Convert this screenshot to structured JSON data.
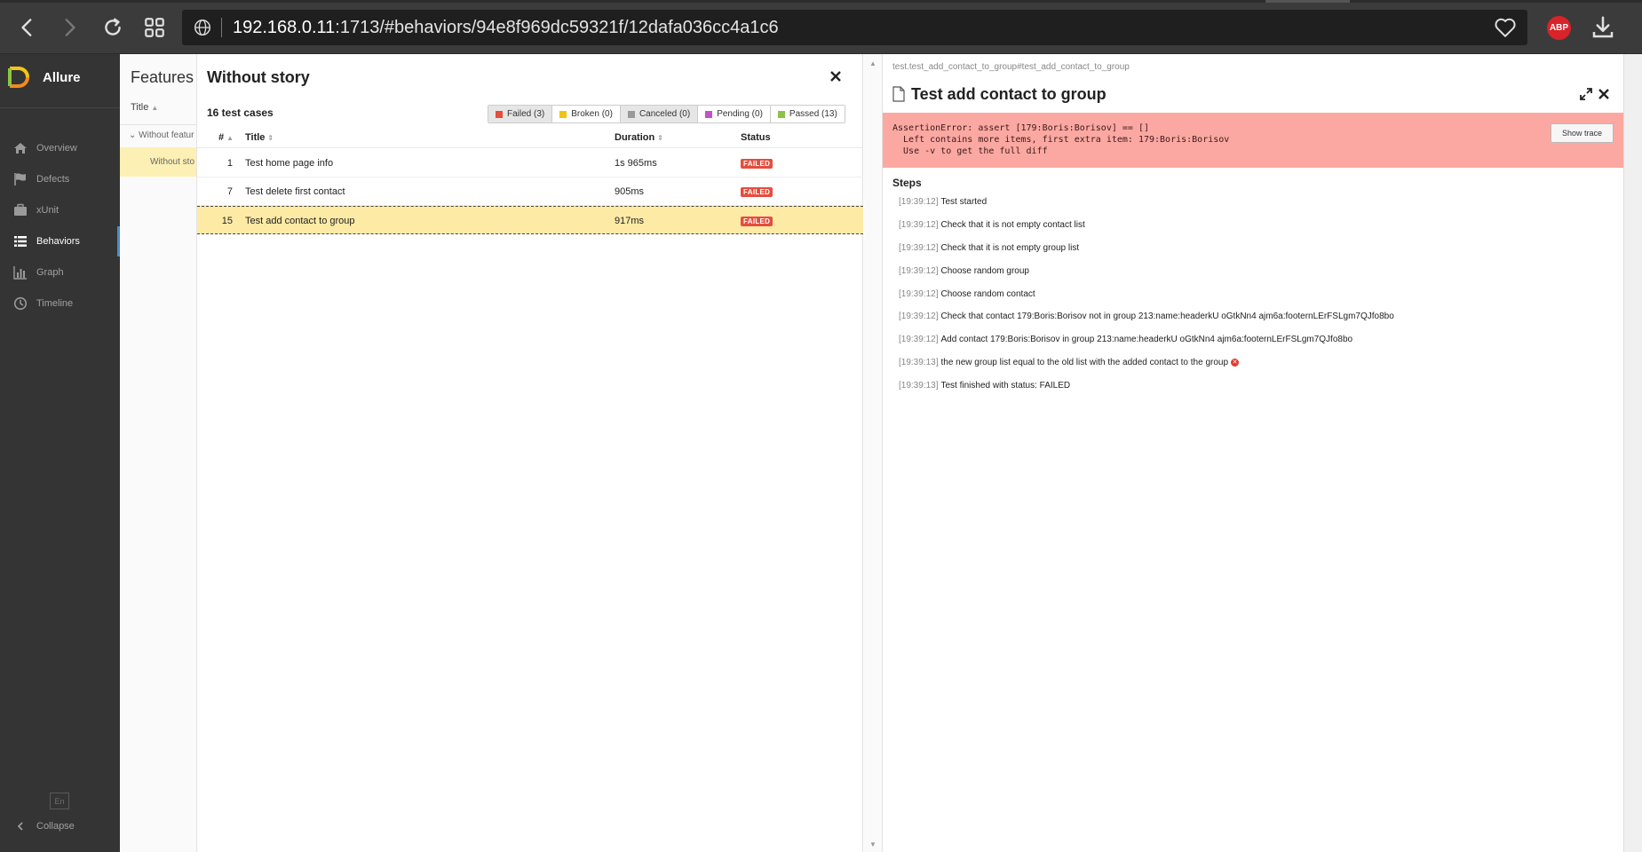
{
  "browser": {
    "url_host": "192.168.0.11",
    "url_rest": ":1713/#behaviors/94e8f969dc59321f/12dafa036cc4a1c6",
    "abp_label": "ABP"
  },
  "sidebar": {
    "brand": "Allure",
    "items": [
      {
        "label": "Overview",
        "icon": "home-icon"
      },
      {
        "label": "Defects",
        "icon": "flag-icon"
      },
      {
        "label": "xUnit",
        "icon": "briefcase-icon"
      },
      {
        "label": "Behaviors",
        "icon": "list-icon",
        "active": true
      },
      {
        "label": "Graph",
        "icon": "bar-chart-icon"
      },
      {
        "label": "Timeline",
        "icon": "clock-icon"
      }
    ],
    "lang": "En",
    "collapse_label": "Collapse"
  },
  "features": {
    "title": "Features",
    "column_title": "Title",
    "group_label": "Without featur",
    "selected_item": "Without sto"
  },
  "list_panel": {
    "title": "Without story",
    "count": "16 test cases",
    "filters": [
      {
        "label": "Failed (3)",
        "color": "#e74c3c",
        "on": true
      },
      {
        "label": "Broken (0)",
        "color": "#f1c40f",
        "on": false
      },
      {
        "label": "Canceled (0)",
        "color": "#999999",
        "on": true
      },
      {
        "label": "Pending (0)",
        "color": "#c352c9",
        "on": false
      },
      {
        "label": "Passed (13)",
        "color": "#8bc34a",
        "on": false
      }
    ],
    "columns": {
      "num": "#",
      "title": "Title",
      "duration": "Duration",
      "status": "Status"
    },
    "rows": [
      {
        "num": "1",
        "title": "Test home page info",
        "duration": "1s 965ms",
        "status": "FAILED"
      },
      {
        "num": "7",
        "title": "Test delete first contact",
        "duration": "905ms",
        "status": "FAILED"
      },
      {
        "num": "15",
        "title": "Test add contact to group",
        "duration": "917ms",
        "status": "FAILED",
        "selected": true
      }
    ]
  },
  "detail": {
    "breadcrumb": "test.test_add_contact_to_group#test_add_contact_to_group",
    "title": "Test add contact to group",
    "error_lines": [
      "AssertionError: assert [179:Boris:Borisov] == []",
      "  Left contains more items, first extra item: 179:Boris:Borisov",
      "  Use -v to get the full diff"
    ],
    "show_trace_label": "Show trace",
    "steps_heading": "Steps",
    "steps": [
      {
        "time": "[19:39:12]",
        "text": "Test started"
      },
      {
        "time": "[19:39:12]",
        "text": "Check that it is not empty contact list"
      },
      {
        "time": "[19:39:12]",
        "text": "Check that it is not empty group list"
      },
      {
        "time": "[19:39:12]",
        "text": "Choose random group"
      },
      {
        "time": "[19:39:12]",
        "text": "Choose random contact"
      },
      {
        "time": "[19:39:12]",
        "text": "Check that contact 179:Boris:Borisov not in group 213:name:headerkU oGtkNn4 ajm6a:footernLErFSLgm7QJfo8bo"
      },
      {
        "time": "[19:39:12]",
        "text": "Add contact 179:Boris:Borisov in group 213:name:headerkU oGtkNn4 ajm6a:footernLErFSLgm7QJfo8bo"
      },
      {
        "time": "[19:39:13]",
        "text": "the new group list equal to the old list with the added contact to the group",
        "failed": true
      },
      {
        "time": "[19:39:13]",
        "text": "Test finished with status: FAILED"
      }
    ]
  }
}
